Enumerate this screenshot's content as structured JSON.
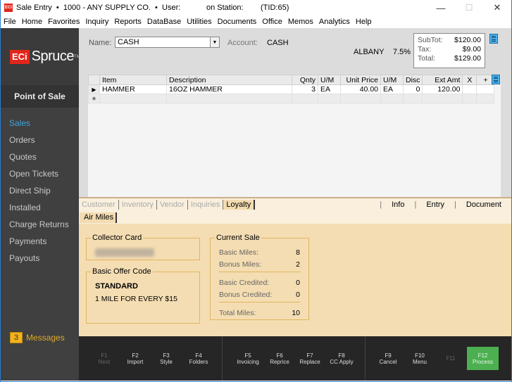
{
  "window": {
    "app_icon": "ECI",
    "title": "Sale Entry  •  1000 - ANY SUPPLY CO.  •  User:            on Station:        (TID:65)",
    "controls": {
      "minimize": "—",
      "maximize": "☐",
      "close": "✕"
    }
  },
  "menubar": [
    "File",
    "Home",
    "Favorites",
    "Inquiry",
    "Reports",
    "DataBase",
    "Utilities",
    "Documents",
    "Office",
    "Memos",
    "Analytics",
    "Help"
  ],
  "sidebar": {
    "logo_eci": "ECi",
    "logo_spruce": "Spruce",
    "logo_tm": "TM",
    "section": "Point of Sale",
    "items": [
      {
        "label": "Sales",
        "active": true
      },
      {
        "label": "Orders"
      },
      {
        "label": "Quotes"
      },
      {
        "label": "Open Tickets"
      },
      {
        "label": "Direct Ship"
      },
      {
        "label": "Installed"
      },
      {
        "label": "Charge Returns"
      },
      {
        "label": "Payments"
      },
      {
        "label": "Payouts"
      }
    ],
    "messages": {
      "count": "3",
      "label": "Messages"
    }
  },
  "header": {
    "name_label": "Name:",
    "name_value": "CASH",
    "account_label": "Account:",
    "account_value": "CASH",
    "location": "ALBANY",
    "tax_rate": "7.5%",
    "totals": {
      "subtotal_label": "SubTot:",
      "subtotal": "$120.00",
      "tax_label": "Tax:",
      "tax": "$9.00",
      "total_label": "Total:",
      "total": "$129.00"
    }
  },
  "grid": {
    "columns": [
      "Item",
      "Description",
      "Qnty",
      "U/M",
      "Unit Price",
      "U/M",
      "Disc",
      "Ext Amt",
      "X",
      "+"
    ],
    "rows": [
      {
        "item": "HAMMER",
        "description": "16OZ HAMMER",
        "qnty": "3",
        "um": "EA",
        "unit_price": "40.00",
        "um2": "EA",
        "disc": "0",
        "ext_amt": "120.00",
        "x": "",
        "plus": ""
      }
    ],
    "current_row_marker": "▶",
    "new_row_marker": "✳"
  },
  "bottom_tabs": {
    "left": [
      "Customer",
      "Inventory",
      "Vendor",
      "Inquiries",
      "Loyalty"
    ],
    "active": "Loyalty",
    "right": [
      "Info",
      "Entry",
      "Document"
    ],
    "separator": "|"
  },
  "sub_tabs": [
    "Air Miles"
  ],
  "loyalty": {
    "collector_card_label": "Collector Card",
    "collector_card_value": "",
    "offer_label": "Basic Offer Code",
    "offer_code": "STANDARD",
    "offer_desc": "1 MILE FOR EVERY $15",
    "current_sale_label": "Current Sale",
    "basic_miles_label": "Basic Miles:",
    "basic_miles": "8",
    "bonus_miles_label": "Bonus Miles:",
    "bonus_miles": "2",
    "basic_credited_label": "Basic Credited:",
    "basic_credited": "0",
    "bonus_credited_label": "Bonus Credited:",
    "bonus_credited": "0",
    "total_miles_label": "Total Miles:",
    "total_miles": "10"
  },
  "fkeys": [
    {
      "key": "F1",
      "label": "Next",
      "disabled": true
    },
    {
      "key": "F2",
      "label": "Import"
    },
    {
      "key": "F3",
      "label": "Style"
    },
    {
      "key": "F4",
      "label": "Folders"
    },
    {
      "key": "F5",
      "label": "Invoicing"
    },
    {
      "key": "F6",
      "label": "Reprice"
    },
    {
      "key": "F7",
      "label": "Replace"
    },
    {
      "key": "F8",
      "label": "CC Apply"
    },
    {
      "key": "F9",
      "label": "Cancel"
    },
    {
      "key": "F10",
      "label": "Menu"
    },
    {
      "key": "F11",
      "label": "",
      "disabled": true
    },
    {
      "key": "F12",
      "label": "Process",
      "primary": true
    }
  ],
  "colors": {
    "accent_blue": "#3fa3dd",
    "brand_red": "#e1261c",
    "process_green": "#4cb050",
    "messages_yellow": "#f3b21b",
    "loyalty_bg": "#f4ddb2"
  }
}
